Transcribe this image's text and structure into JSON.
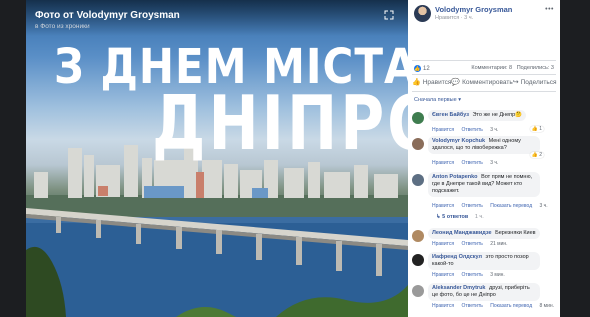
{
  "photo": {
    "title": "Фото от Volodymyr Groysman",
    "subtitle": "в Фото из хроники",
    "headline_line1": "З ДНЕМ МІСТА",
    "headline_line2": "ДНІПРО!"
  },
  "post": {
    "author": "Volodymyr Groysman",
    "liked_label": "Нравится",
    "time": "3 ч.",
    "reaction_count": "12",
    "comments_count": "Комментарии: 8",
    "shares_count": "Поделились: 3"
  },
  "actions": {
    "like": "Нравится",
    "comment": "Комментировать",
    "share": "Поделиться"
  },
  "sort_label": "Сначала первые",
  "comments": [
    {
      "name": "Євген Байбуз",
      "text": "Это же не Днепр🤔",
      "like": "Нравится",
      "reply": "Ответить",
      "time": "3 ч.",
      "reactions": "1"
    },
    {
      "name": "Volodymyr Kopchuk",
      "text": "Мені одному здалося, що то лівобережка?",
      "like": "Нравится",
      "reply": "Ответить",
      "time": "3 ч.",
      "reactions": "2"
    },
    {
      "name": "Anton Potapenko",
      "text": "Вот прям не помню, где в Днепре такой вид? Может кто подскажет.",
      "like": "Нравится",
      "reply": "Ответить",
      "see_translation": "Показать перевод",
      "time": "3 ч."
    },
    {
      "name": "Леонид Манджавидзе",
      "text": "Березняки Киев",
      "like": "Нравится",
      "reply": "Ответить",
      "time": "21 мин."
    },
    {
      "name": "Иафренд Олдскул",
      "text": "это просто позор какой-то",
      "like": "Нравится",
      "reply": "Ответить",
      "time": "3 мин."
    },
    {
      "name": "Aleksander Dmytruk",
      "text": "друзі, приберіть це фото, бо це не Дніпро",
      "like": "Нравится",
      "reply": "Ответить",
      "see_translation": "Показать перевод",
      "time": "8 мин."
    }
  ],
  "replies": {
    "label": "5 ответов",
    "time": "1 ч."
  },
  "colors": {
    "link": "#385898",
    "like_blue": "#1877f2",
    "dark_bg": "#1c1e21"
  },
  "icons": {
    "expand": "expand-icon",
    "more": "more-options-icon",
    "like": "thumbs-up-icon",
    "comment": "comment-icon",
    "share": "share-icon"
  }
}
